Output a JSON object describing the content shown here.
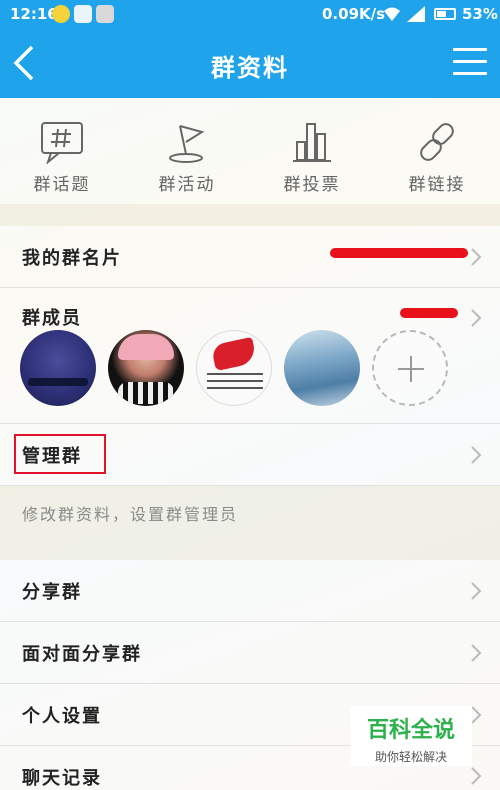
{
  "status_bar": {
    "time": "12:16",
    "network_speed": "0.09K/s",
    "battery_percent": "53%",
    "icons": [
      "app-notification-icon",
      "app-notification-icon",
      "app-notification-icon",
      "wifi-icon",
      "signal-icon",
      "battery-icon"
    ]
  },
  "navbar": {
    "title": "群资料",
    "back_icon": "back-arrow-icon",
    "menu_icon": "menu-icon"
  },
  "quick_actions": [
    {
      "label": "群话题",
      "icon": "hashtag-icon"
    },
    {
      "label": "群活动",
      "icon": "flag-icon"
    },
    {
      "label": "群投票",
      "icon": "bar-chart-icon"
    },
    {
      "label": "群链接",
      "icon": "link-icon"
    }
  ],
  "rows": {
    "my_card": {
      "label": "我的群名片"
    },
    "members": {
      "label": "群成员"
    },
    "manage": {
      "label": "管理群",
      "hint": "修改群资料，设置群管理员"
    },
    "share": {
      "label": "分享群"
    },
    "face_share": {
      "label": "面对面分享群"
    },
    "personal_settings": {
      "label": "个人设置"
    },
    "chat_history": {
      "label": "聊天记录"
    }
  },
  "watermark": {
    "title": "百科全说",
    "subtitle": "助你轻松解决"
  },
  "colors": {
    "primary": "#1fa3ea",
    "redaction": "#e8121b",
    "highlight": "#e3132b",
    "watermark_green": "#2db14b"
  }
}
